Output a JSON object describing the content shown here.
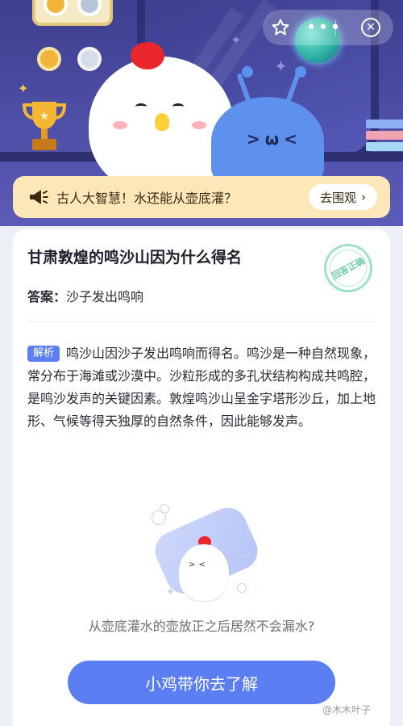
{
  "colors": {
    "hero_bg": "#4e4fa6",
    "topic_bg": "#fce7b9",
    "accent_blue": "#5b7ef3",
    "tag_blue": "#5c7ef2",
    "stamp_green": "#6fcfa7"
  },
  "header": {
    "icons": [
      "star-icon",
      "more-dots-icon",
      "close-icon"
    ]
  },
  "topic": {
    "text": "古人大智慧！水还能从壶底灌？",
    "button_label": "去围观",
    "button_chevron": "›"
  },
  "question": {
    "title": "甘肃敦煌的鸣沙山因为什么得名",
    "answer_key": "答案：",
    "answer_value": "沙子发出鸣响",
    "stamp_text": "回答正确"
  },
  "explanation": {
    "tag": "解析",
    "text": "鸣沙山因沙子发出鸣响而得名。鸣沙是一种自然现象，常分布于海滩或沙漠中。沙粒形成的多孔状结构构成共鸣腔，是鸣沙发声的关键因素。敦煌鸣沙山呈金字塔形沙丘，加上地形、气候等得天独厚的自然条件，因此能够发声。"
  },
  "next": {
    "teaser": "从壶底灌水的壶放正之后居然不会漏水?",
    "cta_label": "小鸡带你去了解"
  },
  "watermark": "@木木叶子"
}
